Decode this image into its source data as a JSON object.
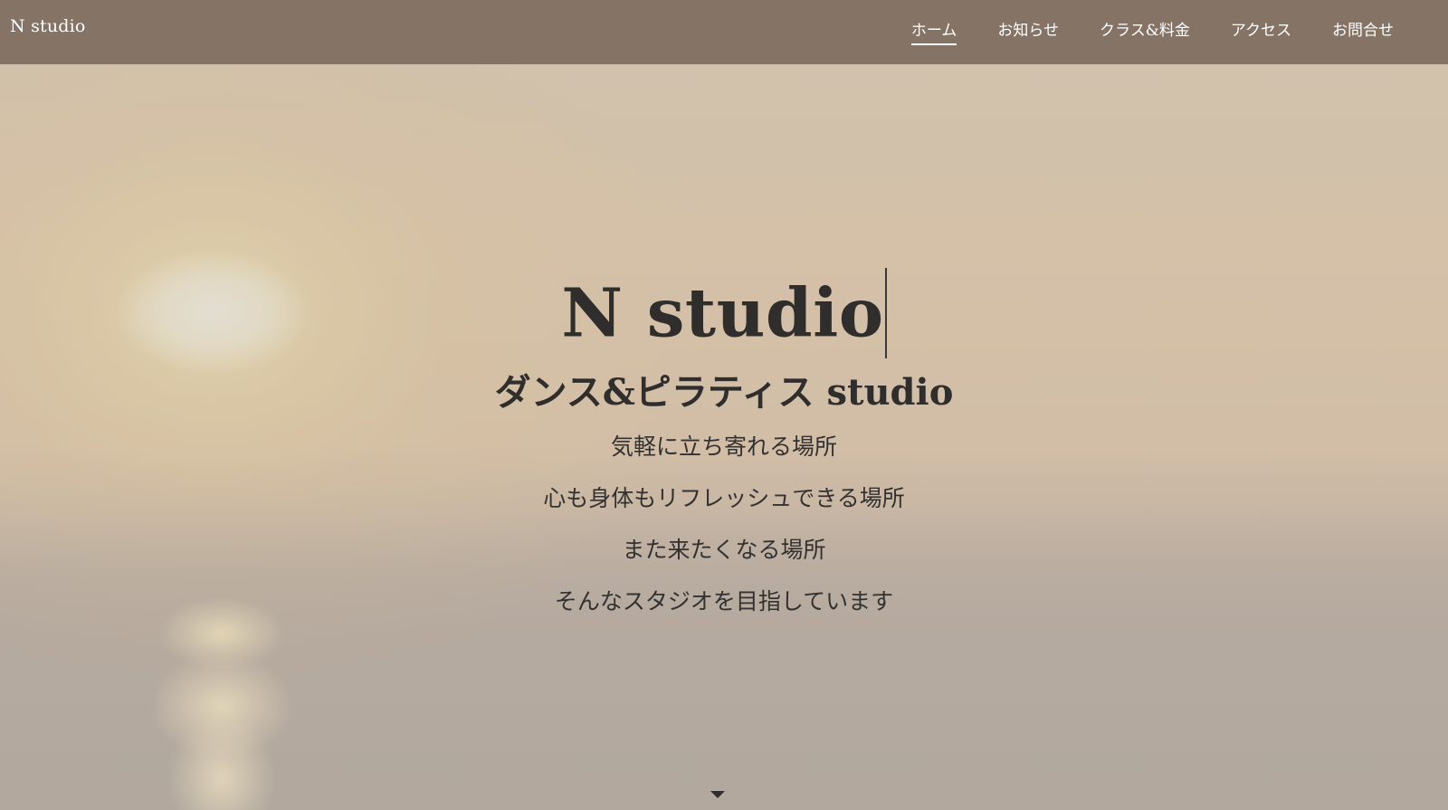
{
  "header": {
    "brand": "N studio",
    "nav": [
      {
        "label": "ホーム",
        "active": true
      },
      {
        "label": "お知らせ",
        "active": false
      },
      {
        "label": "クラス&料金",
        "active": false
      },
      {
        "label": "アクセス",
        "active": false
      },
      {
        "label": "お問合せ",
        "active": false
      }
    ]
  },
  "hero": {
    "title": "N studio",
    "subtitle": "ダンス&ピラティス studio",
    "taglines": [
      "気軽に立ち寄れる場所",
      "心も身体もリフレッシュできる場所",
      "また来たくなる場所",
      "そんなスタジオを目指しています"
    ],
    "scroll_icon": "caret-down-icon"
  },
  "colors": {
    "header_bg": "#857465",
    "header_text": "#ffffff",
    "hero_text": "#2f2e2d"
  }
}
